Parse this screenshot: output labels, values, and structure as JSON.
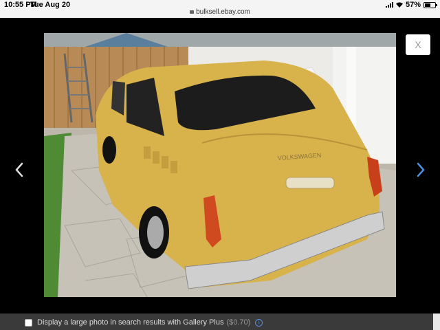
{
  "status": {
    "time": "10:55 PM",
    "date": "Tue Aug 20",
    "url": "bulksell.ebay.com",
    "battery": "57%",
    "battery_level": 0.57
  },
  "viewer": {
    "close_label": "X"
  },
  "gallery_plus": {
    "label": "Display a large photo in search results with Gallery Plus",
    "price": "($0.70)"
  },
  "photo": {
    "car_emblem": "VOLKSWAGEN"
  },
  "colors": {
    "car": "#d8b24a",
    "arrow": "#4a90e2"
  },
  "icons": [
    "lock-icon",
    "signal-icon",
    "wifi-icon",
    "battery-icon",
    "chevron-left-icon",
    "chevron-right-icon",
    "info-icon"
  ]
}
